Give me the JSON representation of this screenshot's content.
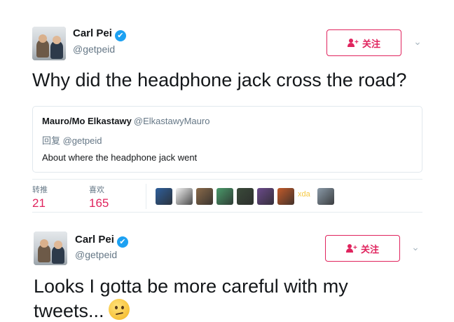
{
  "tweet1": {
    "author": {
      "name": "Carl Pei",
      "handle": "@getpeid",
      "verified_icon": "✔"
    },
    "follow_label": "关注",
    "text": "Why did the headphone jack cross the road?",
    "quote": {
      "author_name": "Mauro/Mo Elkastawy",
      "author_handle": "@ElkastawyMauro",
      "reply_to": "回复 @getpeid",
      "text": "About where the headphone jack went"
    },
    "stats": {
      "retweets_label": "转推",
      "retweets": "21",
      "likes_label": "喜欢",
      "likes": "165"
    },
    "likers_badge": "xda",
    "liker_colors": [
      "#2f5f9c",
      "#f1f1f1",
      "#8a6a4a",
      "#4a9a6a",
      "#3a4a3a",
      "#6a4a8a",
      "#c25a2a",
      "#8a9aa8"
    ]
  },
  "tweet2": {
    "author": {
      "name": "Carl Pei",
      "handle": "@getpeid",
      "verified_icon": "✔"
    },
    "follow_label": "关注",
    "text_line1": "Looks I gotta be more careful with my",
    "text_line2": "tweets...",
    "emoji": "confused-face"
  },
  "colors": {
    "accent": "#e0245e",
    "verified": "#1da1f2",
    "muted": "#657786",
    "border": "#e1e8ed"
  }
}
